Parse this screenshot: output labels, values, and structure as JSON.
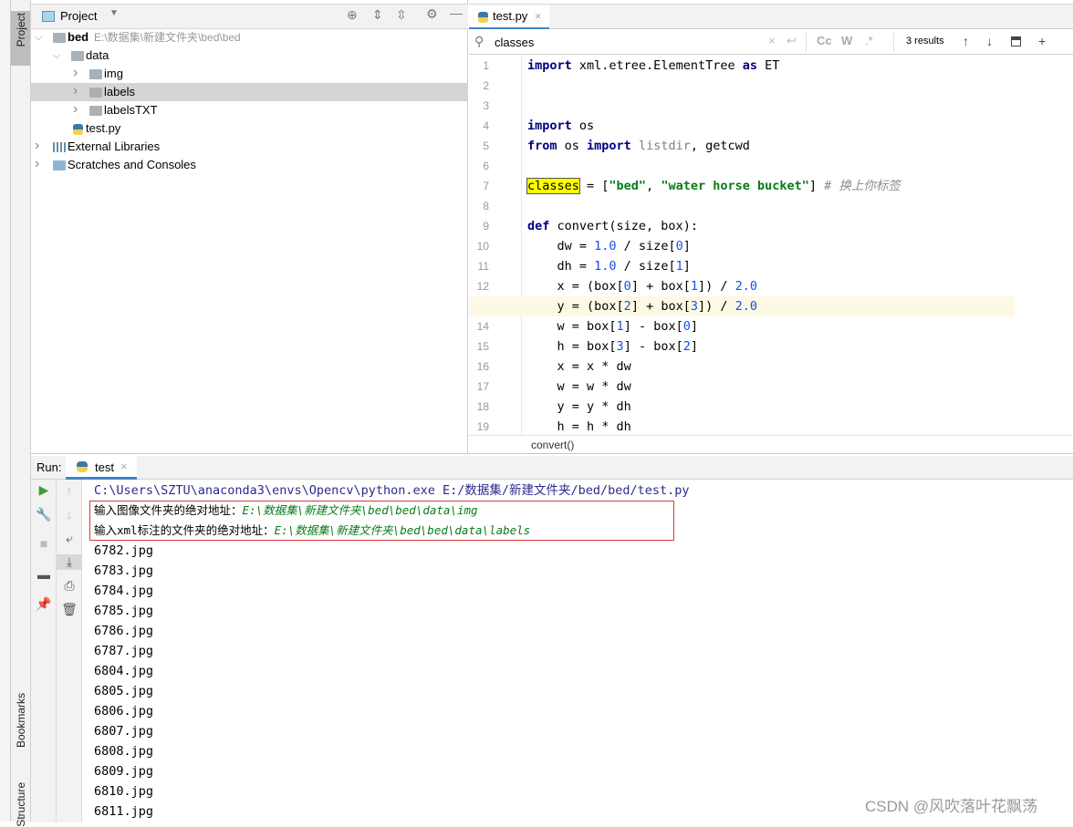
{
  "sidebar": {
    "project_tab": "Project",
    "bookmarks_tab": "Bookmarks",
    "structure_tab": "Structure"
  },
  "project": {
    "title": "Project",
    "root_name": "bed",
    "root_path": "E:\\数据集\\新建文件夹\\bed\\bed",
    "items": [
      {
        "label": "data",
        "icon": "folder-icon"
      },
      {
        "label": "img",
        "icon": "folder-icon"
      },
      {
        "label": "labels",
        "icon": "folder-icon",
        "selected": true
      },
      {
        "label": "labelsTXT",
        "icon": "folder-icon"
      },
      {
        "label": "test.py",
        "icon": "python-file-icon"
      },
      {
        "label": "External Libraries",
        "icon": "library-icon"
      },
      {
        "label": "Scratches and Consoles",
        "icon": "scratches-icon"
      }
    ]
  },
  "editor": {
    "tab": "test.py",
    "search_query": "classes",
    "search_results": "3 results",
    "search_opts": [
      "Cc",
      "W",
      ".*"
    ],
    "breadcrumb": "convert()",
    "current_line": 13,
    "lines": [
      [
        [
          "import",
          "kw"
        ],
        [
          " xml.etree.ElementTree ",
          ""
        ],
        [
          "as",
          "kw"
        ],
        [
          " ET",
          ""
        ]
      ],
      [],
      [],
      [
        [
          "import",
          "kw"
        ],
        [
          " os",
          ""
        ]
      ],
      [
        [
          "from",
          "kw"
        ],
        [
          " os ",
          ""
        ],
        [
          "import",
          "kw"
        ],
        [
          " ",
          ""
        ],
        [
          "listdir",
          "dim"
        ],
        [
          ", getcwd",
          ""
        ]
      ],
      [],
      [
        [
          "classes",
          "hl"
        ],
        [
          " = [",
          ""
        ],
        [
          "\"bed\"",
          "str"
        ],
        [
          ", ",
          ""
        ],
        [
          "\"water horse bucket\"",
          "str"
        ],
        [
          "] ",
          ""
        ],
        [
          "# 换上你标签",
          "cm"
        ]
      ],
      [],
      [
        [
          "def",
          "kw"
        ],
        [
          " convert(size, box):",
          ""
        ]
      ],
      [
        [
          "    dw = ",
          ""
        ],
        [
          "1.0",
          "num"
        ],
        [
          " / size[",
          ""
        ],
        [
          "0",
          "num"
        ],
        [
          "]",
          ""
        ]
      ],
      [
        [
          "    dh = ",
          ""
        ],
        [
          "1.0",
          "num"
        ],
        [
          " / size[",
          ""
        ],
        [
          "1",
          "num"
        ],
        [
          "]",
          ""
        ]
      ],
      [
        [
          "    x = (box[",
          ""
        ],
        [
          "0",
          "num"
        ],
        [
          "] + box[",
          ""
        ],
        [
          "1",
          "num"
        ],
        [
          "]) / ",
          ""
        ],
        [
          "2.0",
          "num"
        ]
      ],
      [
        [
          "    y = (box[",
          ""
        ],
        [
          "2",
          "num"
        ],
        [
          "] + box[",
          ""
        ],
        [
          "3",
          "num"
        ],
        [
          "]) / ",
          ""
        ],
        [
          "2.0",
          "num"
        ]
      ],
      [
        [
          "    w = box[",
          ""
        ],
        [
          "1",
          "num"
        ],
        [
          "] - box[",
          ""
        ],
        [
          "0",
          "num"
        ],
        [
          "]",
          ""
        ]
      ],
      [
        [
          "    h = box[",
          ""
        ],
        [
          "3",
          "num"
        ],
        [
          "] - box[",
          ""
        ],
        [
          "2",
          "num"
        ],
        [
          "]",
          ""
        ]
      ],
      [
        [
          "    x = x * dw",
          ""
        ]
      ],
      [
        [
          "    w = w * dw",
          ""
        ]
      ],
      [
        [
          "    y = y * dh",
          ""
        ]
      ],
      [
        [
          "    h = h * dh",
          ""
        ]
      ]
    ]
  },
  "run": {
    "label": "Run:",
    "tab": "test",
    "command": "C:\\Users\\SZTU\\anaconda3\\envs\\Opencv\\python.exe E:/数据集/新建文件夹/bed/bed/test.py",
    "prompt1": "输入图像文件夹的绝对地址：",
    "input1": "E:\\数据集\\新建文件夹\\bed\\bed\\data\\img",
    "prompt2": "输入xml标注的文件夹的绝对地址：",
    "input2": "E:\\数据集\\新建文件夹\\bed\\bed\\data\\labels",
    "output": [
      "6782.jpg",
      "6783.jpg",
      "6784.jpg",
      "6785.jpg",
      "6786.jpg",
      "6787.jpg",
      "6804.jpg",
      "6805.jpg",
      "6806.jpg",
      "6807.jpg",
      "6808.jpg",
      "6809.jpg",
      "6810.jpg",
      "6811.jpg"
    ]
  },
  "watermark": "CSDN @风吹落叶花飘荡",
  "colors": {
    "keyword": "#000080",
    "string": "#067d17",
    "number": "#1750eb",
    "highlight": "#ffff00",
    "input": "#067d17",
    "command": "#2b2b8c",
    "box": "#d43a3a"
  }
}
